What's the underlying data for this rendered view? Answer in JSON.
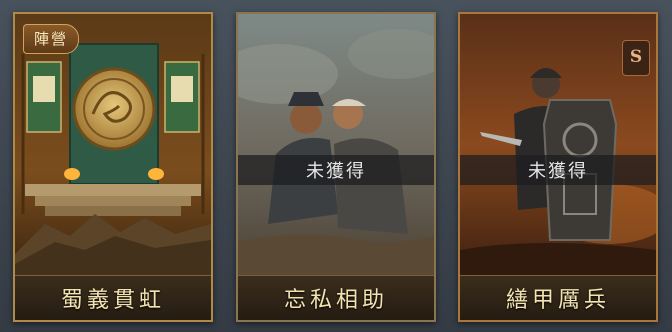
{
  "cards": [
    {
      "title": "蜀義貫虹",
      "badge": "陣營",
      "status": ""
    },
    {
      "title": "忘私相助",
      "status": "未獲得"
    },
    {
      "title": "繕甲厲兵",
      "status": "未獲得",
      "corner_icon": "s-rank-icon",
      "corner_label": "S"
    }
  ],
  "colors": {
    "frame_gold": "#b08a47",
    "title_text": "#f2e3b0",
    "status_bg": "#1c1c1e"
  }
}
